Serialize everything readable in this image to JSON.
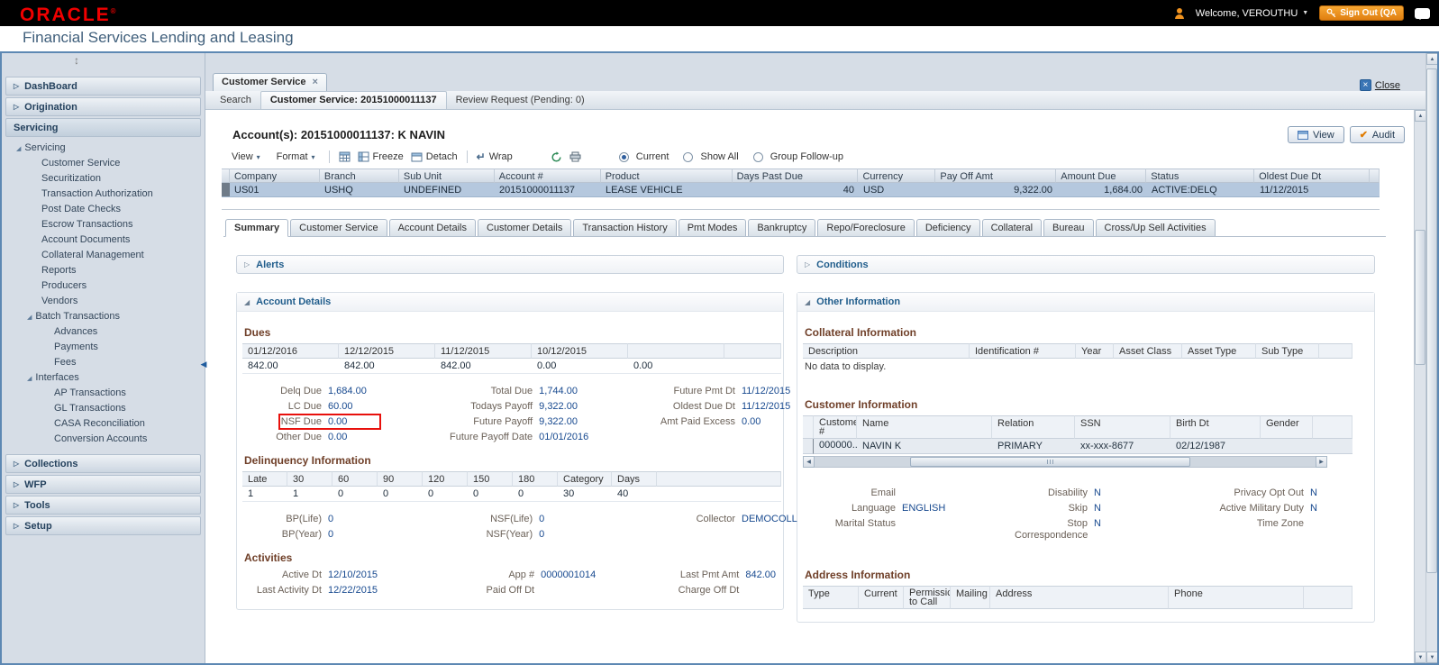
{
  "colors": {
    "brand_red": "#f00000",
    "accent_orange": "#f0931f",
    "selected_row_blue": "#b5c8de",
    "section_heading_maroon": "#6f3f28",
    "value_navy": "#17498f",
    "label_gray": "#6b6158",
    "highlight_box_red": "#e8100c",
    "sidebar_text_navy": "#24415d"
  },
  "icons": {
    "caret_down": "▼",
    "menu_caret": "▾",
    "collapsed_arrow": "▷",
    "expanded_arrow": "◢",
    "close": "×",
    "scroll_up": "▲",
    "scroll_down": "▼",
    "scroll_left": "◀",
    "scroll_right": "▶",
    "collapse_left": "◀",
    "splitter": "↕",
    "check": "✔",
    "wrap_arrow": "↵"
  },
  "header": {
    "brand": "ORACLE",
    "registered": "®",
    "subtitle": "Financial Services Lending and Leasing",
    "welcome": "Welcome, VEROUTHU",
    "sign_out": "Sign Out (QA"
  },
  "sidebar": {
    "dashboard": "DashBoard",
    "origination": "Origination",
    "servicing_header": "Servicing",
    "tree_root": "Servicing",
    "servicing_items": [
      "Customer Service",
      "Securitization",
      "Transaction Authorization",
      "Post Date Checks",
      "Escrow Transactions",
      "Account Documents",
      "Collateral Management",
      "Reports",
      "Producers",
      "Vendors"
    ],
    "batch_label": "Batch Transactions",
    "batch_items": [
      "Advances",
      "Payments",
      "Fees"
    ],
    "interfaces_label": "Interfaces",
    "interfaces_items": [
      "AP Transactions",
      "GL Transactions",
      "CASA Reconciliation",
      "Conversion Accounts"
    ],
    "collections": "Collections",
    "wfp": "WFP",
    "tools": "Tools",
    "setup": "Setup"
  },
  "window_tab": {
    "label": "Customer Service",
    "close_label": "Close"
  },
  "subtabs": {
    "search": "Search",
    "customer_service": "Customer Service: 20151000011137",
    "review_request": "Review Request (Pending: 0)"
  },
  "account_header": {
    "title": "Account(s): 20151000011137: K NAVIN",
    "view_button": "View",
    "audit_button": "Audit"
  },
  "toolbar": {
    "view_menu": "View",
    "format_menu": "Format",
    "freeze": "Freeze",
    "detach": "Detach",
    "wrap": "Wrap",
    "radio_current": "Current",
    "radio_show_all": "Show All",
    "radio_group_follow_up": "Group Follow-up"
  },
  "account_grid": {
    "columns": [
      "Company",
      "Branch",
      "Sub Unit",
      "Account #",
      "Product",
      "Days Past Due",
      "Currency",
      "Pay Off Amt",
      "Amount Due",
      "Status",
      "Oldest Due Dt"
    ],
    "row": [
      "US01",
      "USHQ",
      "UNDEFINED",
      "20151000011137",
      "LEASE VEHICLE",
      "40",
      "USD",
      "9,322.00",
      "1,684.00",
      "ACTIVE:DELQ",
      "11/12/2015"
    ]
  },
  "detail_tabs": [
    "Summary",
    "Customer Service",
    "Account Details",
    "Customer Details",
    "Transaction History",
    "Pmt Modes",
    "Bankruptcy",
    "Repo/Foreclosure",
    "Deficiency",
    "Collateral",
    "Bureau",
    "Cross/Up Sell Activities"
  ],
  "left_panel": {
    "alerts_header": "Alerts",
    "account_details_header": "Account Details",
    "dues_heading": "Dues",
    "dues_columns": [
      "01/12/2016",
      "12/12/2015",
      "11/12/2015",
      "10/12/2015",
      ""
    ],
    "dues_values": [
      "842.00",
      "842.00",
      "842.00",
      "0.00",
      "0.00"
    ],
    "dues_col1": [
      {
        "label": "Delq Due",
        "value": "1,684.00"
      },
      {
        "label": "LC Due",
        "value": "60.00"
      },
      {
        "label": "NSF Due",
        "value": "0.00"
      },
      {
        "label": "Other Due",
        "value": "0.00"
      }
    ],
    "dues_col2": [
      {
        "label": "Total Due",
        "value": "1,744.00"
      },
      {
        "label": "Todays Payoff",
        "value": "9,322.00"
      },
      {
        "label": "Future Payoff",
        "value": "9,322.00"
      },
      {
        "label": "Future Payoff Date",
        "value": "01/01/2016"
      }
    ],
    "dues_col3": [
      {
        "label": "Future Pmt Dt",
        "value": "11/12/2015"
      },
      {
        "label": "Oldest Due Dt",
        "value": "11/12/2015"
      },
      {
        "label": "Amt Paid Excess",
        "value": "0.00"
      }
    ],
    "delinquency_heading": "Delinquency Information",
    "delinquency_columns": [
      "Late",
      "30",
      "60",
      "90",
      "120",
      "150",
      "180",
      "Category",
      "Days"
    ],
    "delinquency_values": [
      "1",
      "1",
      "0",
      "0",
      "0",
      "0",
      "0",
      "30",
      "40"
    ],
    "stats_col1": [
      {
        "label": "BP(Life)",
        "value": "0"
      },
      {
        "label": "BP(Year)",
        "value": "0"
      }
    ],
    "stats_col2": [
      {
        "label": "NSF(Life)",
        "value": "0"
      },
      {
        "label": "NSF(Year)",
        "value": "0"
      }
    ],
    "stats_col3": [
      {
        "label": "Collector",
        "value": "DEMOCOLL"
      }
    ],
    "activities_heading": "Activities",
    "activities_col1": [
      {
        "label": "Active Dt",
        "value": "12/10/2015"
      },
      {
        "label": "Last Activity Dt",
        "value": "12/22/2015"
      }
    ],
    "activities_col2": [
      {
        "label": "App #",
        "value": "0000001014"
      },
      {
        "label": "Paid Off Dt",
        "value": ""
      }
    ],
    "activities_col3": [
      {
        "label": "Last Pmt Amt",
        "value": "842.00"
      },
      {
        "label": "Charge Off Dt",
        "value": ""
      }
    ]
  },
  "right_panel": {
    "conditions_header": "Conditions",
    "other_information_header": "Other Information",
    "collateral_heading": "Collateral Information",
    "collateral_columns": [
      "Description",
      "Identification #",
      "Year",
      "Asset Class",
      "Asset Type",
      "Sub Type"
    ],
    "collateral_empty": "No data to display.",
    "customer_heading": "Customer Information",
    "customer_columns": [
      "Customer #",
      "Name",
      "Relation",
      "SSN",
      "Birth Dt",
      "Gender"
    ],
    "customer_row": [
      "000000...",
      "NAVIN K",
      "PRIMARY",
      "xx-xxx-8677",
      "02/12/1987",
      ""
    ],
    "info_col1": [
      {
        "label": "Email",
        "value": ""
      },
      {
        "label": "Language",
        "value": "ENGLISH"
      },
      {
        "label": "Marital Status",
        "value": ""
      }
    ],
    "info_col2": [
      {
        "label": "Disability",
        "value": "N"
      },
      {
        "label": "Skip",
        "value": "N"
      },
      {
        "label": "Stop Correspondence",
        "value": "N"
      }
    ],
    "info_col3": [
      {
        "label": "Privacy Opt Out",
        "value": "N"
      },
      {
        "label": "Active Military Duty",
        "value": "N"
      },
      {
        "label": "Time Zone",
        "value": ""
      }
    ],
    "address_heading": "Address Information",
    "address_columns": [
      "Type",
      "Current",
      "Permissic to Call",
      "Mailing",
      "Address",
      "Phone"
    ]
  }
}
